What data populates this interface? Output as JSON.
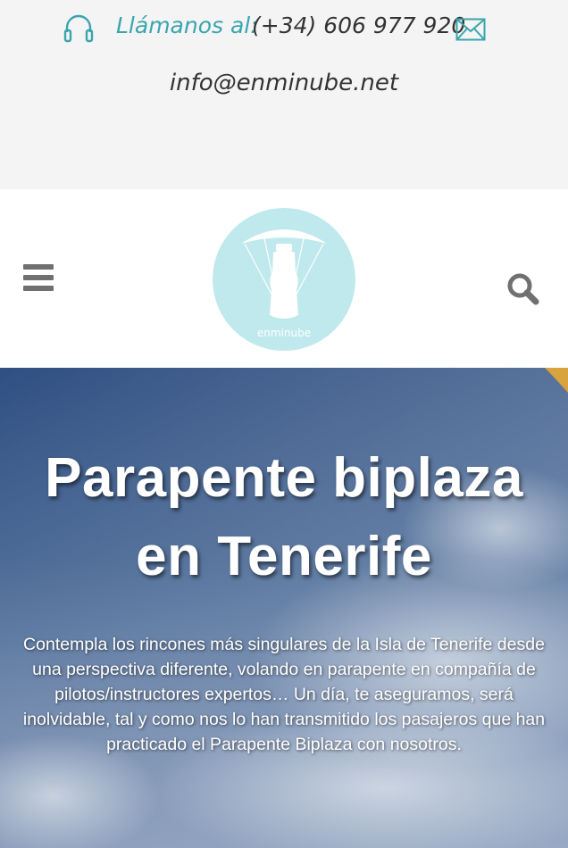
{
  "contact": {
    "call_label": "Llámanos al:",
    "phone": "(+34) 606 977 920",
    "email": "info@enminube.net",
    "headset_icon": "headset-icon",
    "mail_icon": "envelope-icon",
    "accent_color": "#3aa5ad"
  },
  "header": {
    "menu_icon": "hamburger-menu-icon",
    "search_icon": "search-icon",
    "logo_text": "enminube",
    "logo_color": "#bfe9ec"
  },
  "hero": {
    "title_line1": "Parapente biplaza",
    "title_line2": "en Tenerife",
    "description": "Contempla los rincones más singulares de la Isla de Tenerife desde una perspectiva diferente, volando en parapente en compañía de pilotos/instructores expertos… Un día, te aseguramos, será inolvidable, tal y como nos lo han transmitido los pasajeros que han practicado el Parapente Biplaza con nosotros."
  }
}
